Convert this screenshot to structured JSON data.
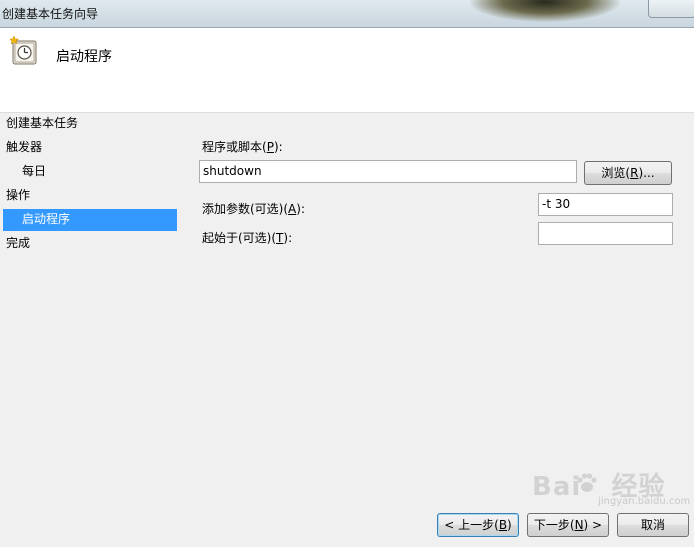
{
  "window": {
    "title": "创建基本任务向导"
  },
  "header": {
    "heading": "启动程序",
    "icon": "clock-icon"
  },
  "sidebar": {
    "items": [
      {
        "label": "创建基本任务"
      },
      {
        "label": "触发器"
      },
      {
        "label": "每日"
      },
      {
        "label": "操作"
      },
      {
        "label": "启动程序"
      },
      {
        "label": "完成"
      }
    ],
    "active_color": "#3399ff"
  },
  "form": {
    "program_label_pre": "程序或脚本(",
    "program_key": "P",
    "program_label_post": "):",
    "program_value": "shutdown",
    "browse_pre": "浏览(",
    "browse_key": "R",
    "browse_post": ")...",
    "args_label_pre": "添加参数(可选)(",
    "args_key": "A",
    "args_label_post": "):",
    "args_value": "-t 30",
    "start_label_pre": "起始于(可选)(",
    "start_key": "T",
    "start_label_post": "):",
    "start_value": ""
  },
  "footer": {
    "back_pre": "< 上一步(",
    "back_key": "B",
    "back_post": ")",
    "next_pre": "下一步(",
    "next_key": "N",
    "next_post": ") >",
    "cancel": "取消"
  },
  "watermark": {
    "brand": "Bai",
    "brand_end": "经验",
    "sub": "jingyan.baidu.com"
  }
}
